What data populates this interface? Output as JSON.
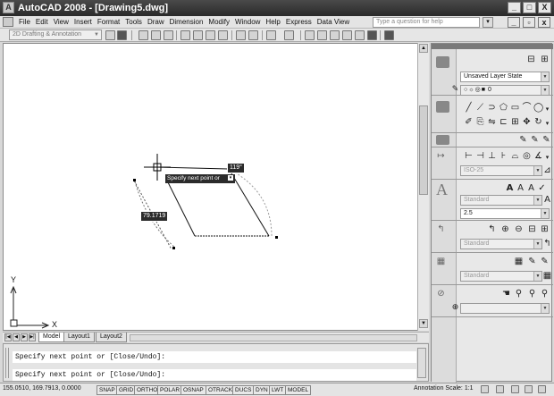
{
  "app": {
    "title": "AutoCAD 2008 - [Drawing5.dwg]",
    "logo": "A"
  },
  "window_controls": {
    "minimize": "_",
    "maximize": "□",
    "close": "X"
  },
  "menu": {
    "items": [
      "File",
      "Edit",
      "View",
      "Insert",
      "Format",
      "Tools",
      "Draw",
      "Dimension",
      "Modify",
      "Window",
      "Help",
      "Express",
      "Data View"
    ],
    "help_placeholder": "Type a question for help"
  },
  "toolbar": {
    "workspace": "2D Drafting & Annotation"
  },
  "drawing": {
    "tooltip": "Specify next point or",
    "angle_value": "119°",
    "length_value": "79.1719",
    "ucs_y": "Y",
    "ucs_x": "X"
  },
  "tabs": {
    "items": [
      "Model",
      "Layout1",
      "Layout2"
    ],
    "active": "Model"
  },
  "command_line": {
    "line1": "Specify next point or [Close/Undo]:",
    "line2": "Specify next point or [Close/Undo]:"
  },
  "status": {
    "coordinates": "155.0510, 169.7913, 0.0000",
    "toggles": [
      "SNAP",
      "GRID",
      "ORTHO",
      "POLAR",
      "OSNAP",
      "OTRACK",
      "DUCS",
      "DYN",
      "LWT",
      "MODEL"
    ],
    "annotation_scale_label": "Annotation Scale:",
    "annotation_scale_value": "1:1"
  },
  "dashboard": {
    "layer_state": "Unsaved Layer State",
    "layer_current": "0",
    "dim_style": "ISO-25",
    "text_style": "Standard",
    "text_height": "2.5",
    "mleader_style": "Standard",
    "table_style": "Standard"
  }
}
